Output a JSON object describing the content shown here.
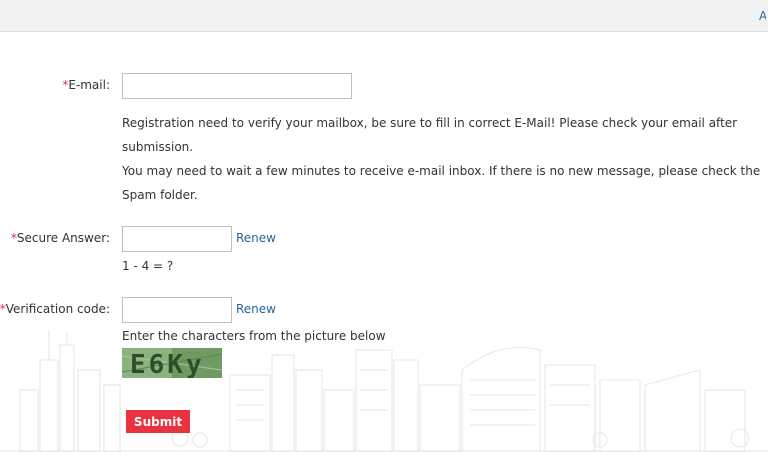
{
  "header": {
    "link_label": "A"
  },
  "form": {
    "required_mark": "*",
    "email": {
      "label": "E-mail:",
      "value": "",
      "placeholder": "",
      "hint_line1": "Registration need to verify your mailbox, be sure to fill in correct E-Mail! Please check your email after",
      "hint_line2": "submission.",
      "hint_line3": "You may need to wait a few minutes to receive e-mail inbox. If there is no new message, please check the",
      "hint_line4": "Spam folder."
    },
    "secure_answer": {
      "label": "Secure Answer:",
      "value": "",
      "renew_label": "Renew",
      "question": "1 - 4 = ?"
    },
    "verification": {
      "label": "Verification code:",
      "value": "",
      "renew_label": "Renew",
      "hint": "Enter the characters from the picture below",
      "captcha_text": "E6Ky"
    },
    "submit_label": "Submit"
  },
  "colors": {
    "required": "#d9333f",
    "link": "#2a6496",
    "submit_bg": "#e8323f",
    "captcha_bg": "#6f9a62"
  }
}
